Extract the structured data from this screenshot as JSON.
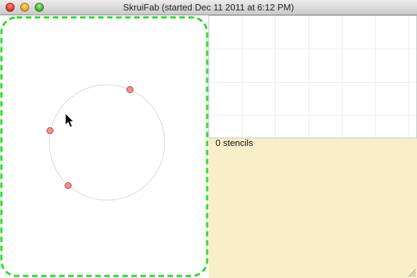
{
  "window": {
    "title": "SkruiFab (started Dec 11 2011 at 6:12 PM)"
  },
  "canvas": {
    "icons": {
      "cursor": "arrow-pointer-icon"
    }
  },
  "stencil_panel": {
    "count_label": "0 stencils"
  },
  "colors": {
    "selection_border": "#22dd22",
    "handle_fill": "#f2908c",
    "panel_background": "#f8efc8"
  }
}
